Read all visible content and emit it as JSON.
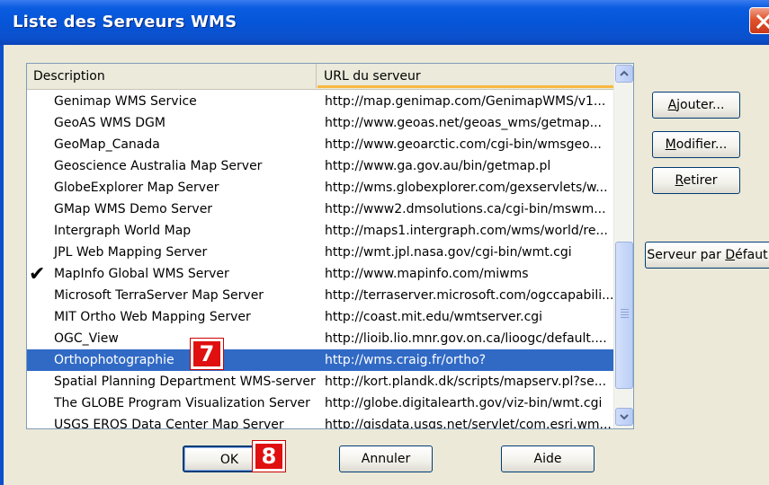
{
  "window": {
    "title": "Liste des Serveurs WMS"
  },
  "list": {
    "columns": {
      "description": "Description",
      "url": "URL du serveur"
    },
    "rows": [
      {
        "name": "Genimap WMS Service",
        "url": "http://map.genimap.com/GenimapWMS/v1...",
        "checked": false,
        "selected": false
      },
      {
        "name": "GeoAS WMS DGM",
        "url": "http://www.geoas.net/geoas_wms/getmap...",
        "checked": false,
        "selected": false
      },
      {
        "name": "GeoMap_Canada",
        "url": "http://www.geoarctic.com/cgi-bin/wmsgeo...",
        "checked": false,
        "selected": false
      },
      {
        "name": "Geoscience Australia Map Server",
        "url": "http://www.ga.gov.au/bin/getmap.pl",
        "checked": false,
        "selected": false
      },
      {
        "name": "GlobeExplorer Map Server",
        "url": "http://wms.globexplorer.com/gexservlets/w...",
        "checked": false,
        "selected": false
      },
      {
        "name": "GMap WMS Demo Server",
        "url": "http://www2.dmsolutions.ca/cgi-bin/mswm...",
        "checked": false,
        "selected": false
      },
      {
        "name": "Intergraph World Map",
        "url": "http://maps1.intergraph.com/wms/world/re...",
        "checked": false,
        "selected": false
      },
      {
        "name": "JPL Web Mapping Server",
        "url": "http://wmt.jpl.nasa.gov/cgi-bin/wmt.cgi",
        "checked": false,
        "selected": false
      },
      {
        "name": "MapInfo Global WMS Server",
        "url": "http://www.mapinfo.com/miwms",
        "checked": true,
        "selected": false
      },
      {
        "name": "Microsoft TerraServer Map Server",
        "url": "http://terraserver.microsoft.com/ogccapabili...",
        "checked": false,
        "selected": false
      },
      {
        "name": "MIT Ortho Web Mapping Server",
        "url": "http://coast.mit.edu/wmtserver.cgi",
        "checked": false,
        "selected": false
      },
      {
        "name": "OGC_View",
        "url": "http://lioib.lio.mnr.gov.on.ca/lioogc/default....",
        "checked": false,
        "selected": false
      },
      {
        "name": "Orthophotographie",
        "url": "http://wms.craig.fr/ortho?",
        "checked": false,
        "selected": true
      },
      {
        "name": "Spatial Planning Department WMS-server",
        "url": "http://kort.plandk.dk/scripts/mapserv.pl?se...",
        "checked": false,
        "selected": false
      },
      {
        "name": "The GLOBE Program Visualization Server",
        "url": "http://globe.digitalearth.gov/viz-bin/wmt.cgi",
        "checked": false,
        "selected": false
      },
      {
        "name": "USGS EROS Data Center Map Server",
        "url": "http://gisdata.usgs.net/servlet/com.esri.wm...",
        "checked": false,
        "selected": false
      }
    ]
  },
  "side_buttons": {
    "add": {
      "label_pre": "",
      "label_mnemonic": "A",
      "label_post": "jouter..."
    },
    "modify": {
      "label_pre": "",
      "label_mnemonic": "M",
      "label_post": "odifier..."
    },
    "remove": {
      "label_pre": "",
      "label_mnemonic": "R",
      "label_post": "etirer"
    },
    "default_server": {
      "label_pre": "Serveur par ",
      "label_mnemonic": "D",
      "label_post": "éfaut"
    }
  },
  "bottom_buttons": {
    "ok": "OK",
    "cancel": "Annuler",
    "help": "Aide"
  },
  "markers": {
    "m7": "7",
    "m8": "8"
  },
  "colors": {
    "titlebar": "#0655d8",
    "selection": "#316ac5",
    "marker": "#e01010",
    "dialog_bg": "#ece9d8"
  }
}
